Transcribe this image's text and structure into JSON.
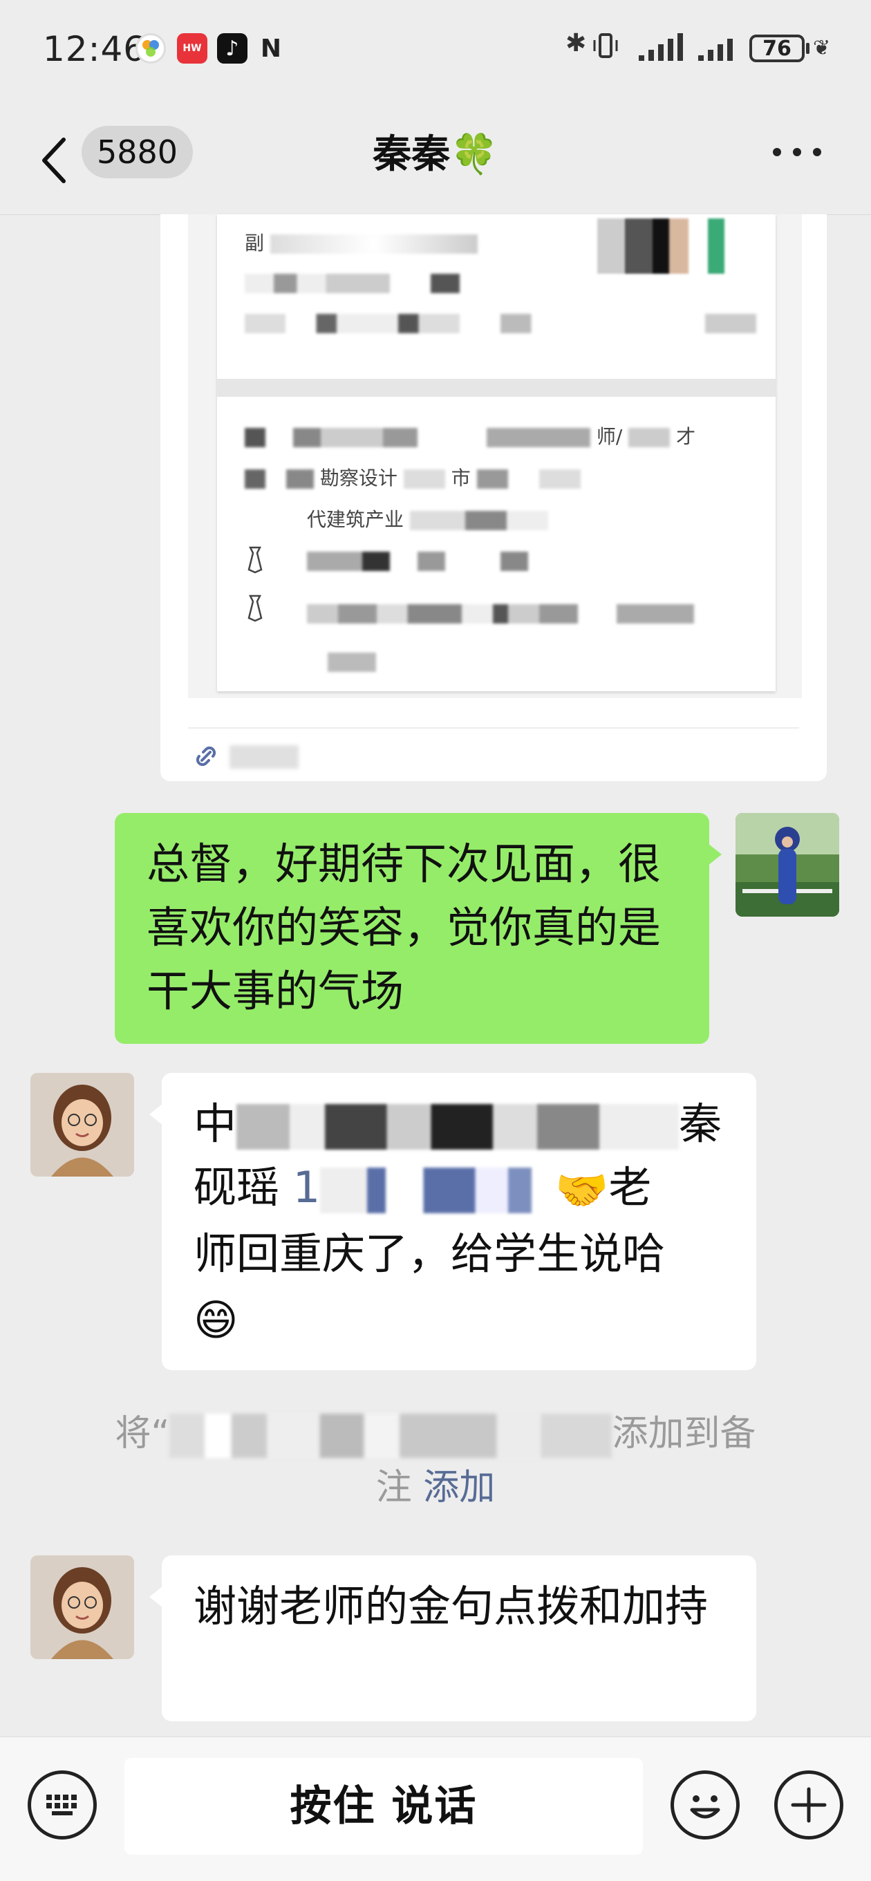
{
  "status_bar": {
    "time": "12:46",
    "battery": "76",
    "app_icons": [
      "photos-icon",
      "huawei-appgallery-icon",
      "tiktok-icon",
      "nfc-icon"
    ]
  },
  "nav": {
    "unread_count": "5880",
    "title": "秦秦🍀"
  },
  "shared_card": {
    "doc_lines": [
      "副",
      "师/",
      "才",
      "勘察设计",
      "市",
      "代建筑产业"
    ]
  },
  "messages": [
    {
      "from": "me",
      "text": "总督，好期待下次见面，很喜欢你的笑容，觉你真的是干大事的气场"
    },
    {
      "from": "other",
      "line1_start": "中",
      "line1_end": "秦",
      "line2_start": "砚瑶",
      "line2_link": "1",
      "line2_end": "老",
      "line3": "师回重庆了，给学生说哈",
      "emoji_handshake": "🤝",
      "emoji_grin": "😄"
    },
    {
      "from": "other",
      "text": "谢谢老师的金句点拨和加持"
    }
  ],
  "system_note": {
    "prefix": "将“",
    "middle": "添加到备",
    "suffix": "注",
    "action": "添加"
  },
  "input_bar": {
    "hold_to_talk": "按住 说话"
  },
  "colors": {
    "background": "#ededed",
    "my_bubble": "#95ec69",
    "other_bubble": "#ffffff",
    "link": "#576b95"
  }
}
